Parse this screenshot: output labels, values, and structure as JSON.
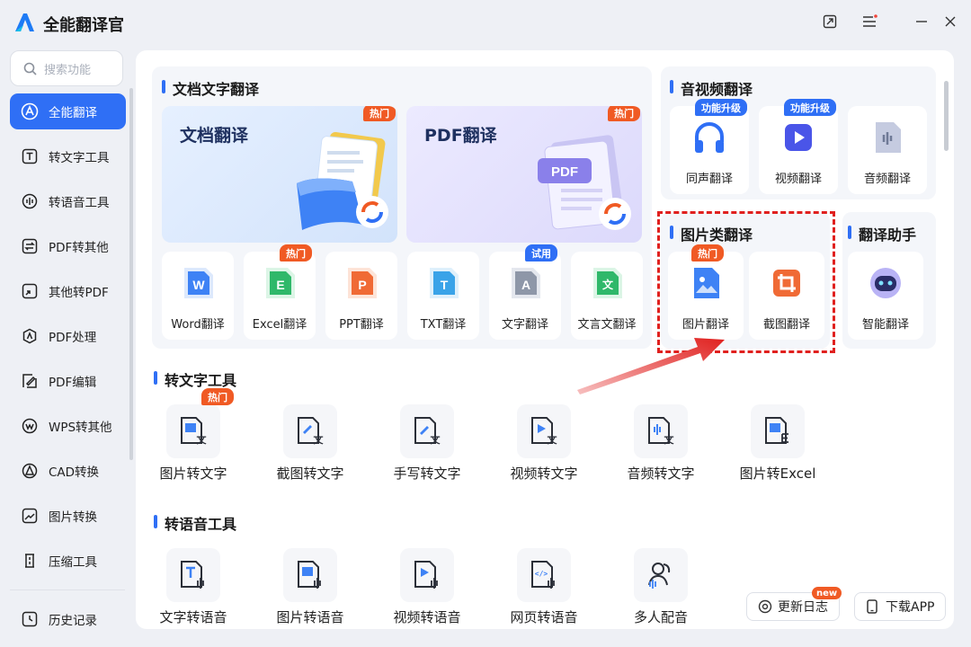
{
  "app": {
    "title": "全能翻译官"
  },
  "colors": {
    "accent": "#2f6ff5",
    "hot": "#f05a24",
    "highlight": "#e0201e"
  },
  "window_controls": [
    "pin-icon",
    "menu-icon",
    "minimize-icon",
    "close-icon"
  ],
  "sidebar": {
    "search_placeholder": "搜索功能",
    "items": [
      {
        "label": "全能翻译",
        "icon": "translate-icon",
        "active": true
      },
      {
        "label": "转文字工具",
        "icon": "text-tool-icon"
      },
      {
        "label": "转语音工具",
        "icon": "audio-tool-icon"
      },
      {
        "label": "PDF转其他",
        "icon": "pdf-convert-icon"
      },
      {
        "label": "其他转PDF",
        "icon": "to-pdf-icon"
      },
      {
        "label": "PDF处理",
        "icon": "pdf-process-icon"
      },
      {
        "label": "PDF编辑",
        "icon": "pdf-edit-icon"
      },
      {
        "label": "WPS转其他",
        "icon": "wps-icon"
      },
      {
        "label": "CAD转换",
        "icon": "cad-icon"
      },
      {
        "label": "图片转换",
        "icon": "image-convert-icon"
      },
      {
        "label": "压缩工具",
        "icon": "compress-icon"
      }
    ],
    "history": {
      "label": "历史记录",
      "icon": "history-icon"
    }
  },
  "doc_section": {
    "title": "文档文字翻译",
    "big_tiles": [
      {
        "label": "文档翻译",
        "badge": "热门"
      },
      {
        "label": "PDF翻译",
        "badge": "热门",
        "art_text": "PDF"
      }
    ],
    "tiles": [
      {
        "label": "Word翻译",
        "letter": "W",
        "badge": ""
      },
      {
        "label": "Excel翻译",
        "letter": "E",
        "badge": "热门"
      },
      {
        "label": "PPT翻译",
        "letter": "P",
        "badge": ""
      },
      {
        "label": "TXT翻译",
        "letter": "T",
        "badge": ""
      },
      {
        "label": "文字翻译",
        "letter": "A",
        "badge": "试用"
      },
      {
        "label": "文言文翻译",
        "letter": "文",
        "badge": ""
      }
    ]
  },
  "av_section": {
    "title": "音视频翻译",
    "tiles": [
      {
        "label": "同声翻译",
        "badge": "功能升级"
      },
      {
        "label": "视频翻译",
        "badge": "功能升级"
      },
      {
        "label": "音频翻译",
        "badge": ""
      }
    ]
  },
  "image_section": {
    "title": "图片类翻译",
    "tiles": [
      {
        "label": "图片翻译",
        "badge": "热门"
      },
      {
        "label": "截图翻译",
        "badge": ""
      }
    ]
  },
  "assistant_section": {
    "title": "翻译助手",
    "tiles": [
      {
        "label": "智能翻译"
      }
    ]
  },
  "text_tools": {
    "title": "转文字工具",
    "items": [
      {
        "label": "图片转文字",
        "badge": "热门"
      },
      {
        "label": "截图转文字"
      },
      {
        "label": "手写转文字"
      },
      {
        "label": "视频转文字"
      },
      {
        "label": "音频转文字"
      },
      {
        "label": "图片转Excel"
      }
    ]
  },
  "voice_tools": {
    "title": "转语音工具",
    "items": [
      {
        "label": "文字转语音"
      },
      {
        "label": "图片转语音"
      },
      {
        "label": "视频转语音"
      },
      {
        "label": "网页转语音"
      },
      {
        "label": "多人配音"
      }
    ]
  },
  "footer": {
    "changelog": {
      "label": "更新日志",
      "badge": "new"
    },
    "download": {
      "label": "下载APP"
    }
  },
  "glyphs": {
    "wen": "文",
    "code": "</>"
  }
}
